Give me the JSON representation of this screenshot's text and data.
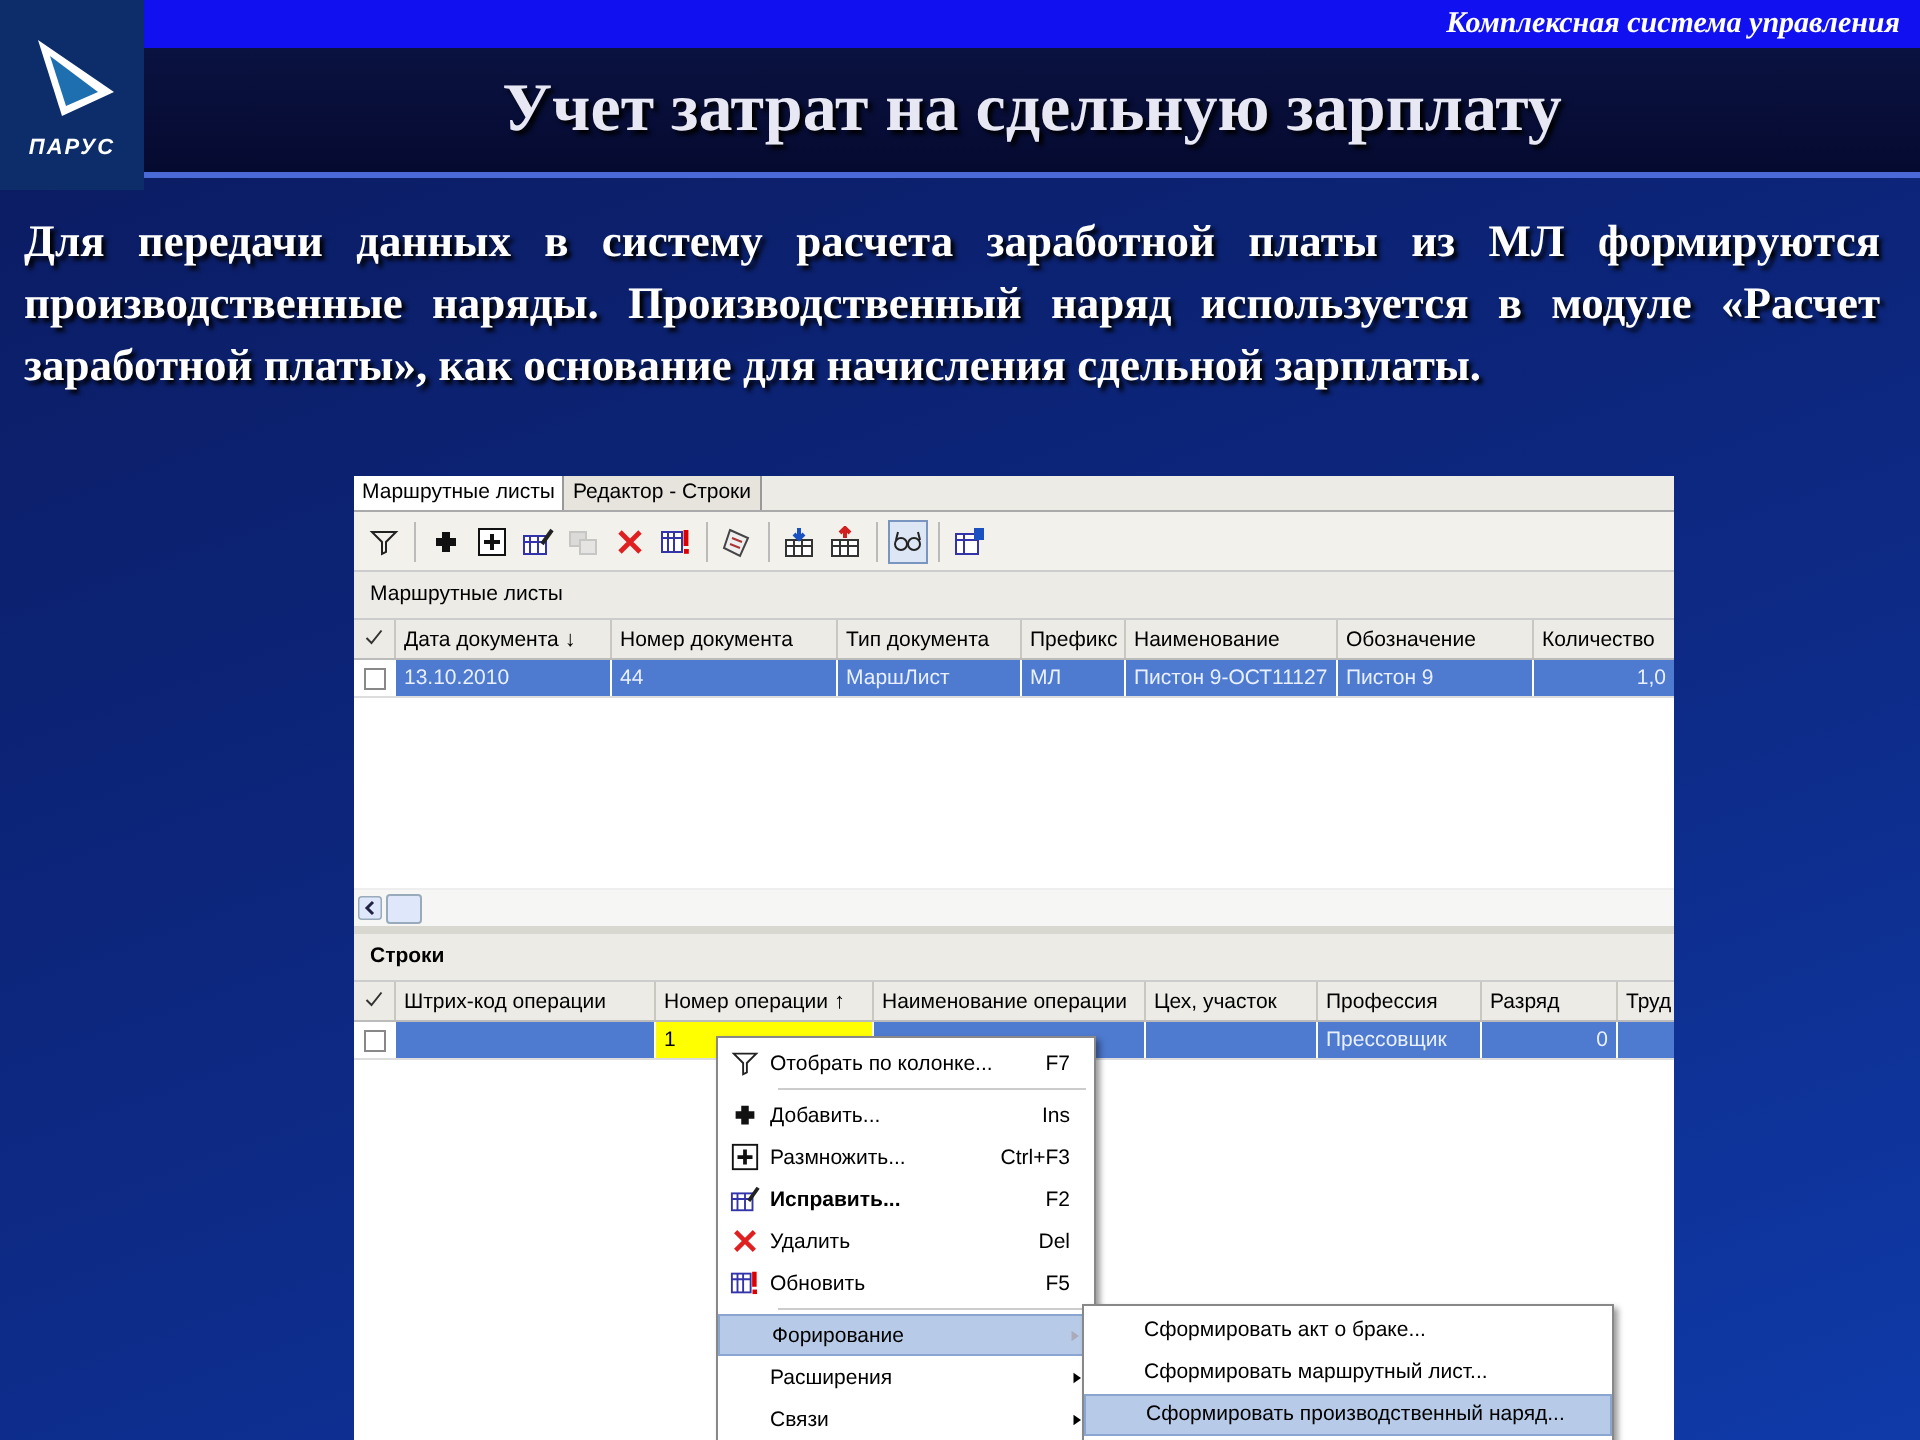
{
  "header": {
    "subtitle": "Комплексная система управления",
    "title": "Учет затрат на сдельную зарплату",
    "logo_text": "ПАРУС"
  },
  "intro": "Для передачи данных в систему расчета заработной платы из МЛ формируются производственные наряды. Производственный наряд используется в модуле «Расчет заработной платы», как основание для начисления сдельной зарплаты.",
  "app": {
    "tabs": [
      {
        "label": "Маршрутные листы",
        "selected": true
      },
      {
        "label": "Редактор - Строки",
        "selected": false
      }
    ],
    "toolbar": [
      {
        "pressed": false
      },
      {
        "pressed": false
      },
      {
        "pressed": false
      },
      {
        "pressed": false
      },
      {
        "pressed": false,
        "disabled": true
      },
      {
        "pressed": false
      },
      {
        "pressed": false
      },
      {
        "pressed": false
      },
      {
        "pressed": false
      },
      {
        "pressed": false
      },
      {
        "pressed": true
      },
      {
        "pressed": false
      }
    ],
    "top_panel": {
      "title": "Маршрутные листы",
      "columns": [
        {
          "label": "Дата документа",
          "sort_arrow": "↓"
        },
        {
          "label": "Номер документа"
        },
        {
          "label": "Тип документа"
        },
        {
          "label": "Префикс"
        },
        {
          "label": "Наименование"
        },
        {
          "label": "Обозначение"
        },
        {
          "label": "Количество"
        }
      ],
      "rows": [
        {
          "checked": false,
          "selected": true,
          "cells": [
            "13.10.2010",
            "44",
            "МаршЛист",
            "МЛ",
            "Пистон 9-ОСТ11127",
            "Пистон 9",
            "1,0"
          ]
        }
      ]
    },
    "bottom_panel": {
      "title": "Строки",
      "columns": [
        {
          "label": "Штрих-код операции"
        },
        {
          "label": "Номер операции",
          "sort_arrow": "↑"
        },
        {
          "label": "Наименование операции"
        },
        {
          "label": "Цех, участок"
        },
        {
          "label": "Профессия"
        },
        {
          "label": "Разряд"
        },
        {
          "label": "Труд"
        }
      ],
      "rows": [
        {
          "checked": false,
          "selected": true,
          "cells": [
            "",
            "1",
            "",
            "",
            "Прессовщик",
            "0",
            ""
          ]
        }
      ]
    },
    "context_menu": [
      {
        "kind": "item",
        "label": "Отобрать по колонке...",
        "shortcut": "F7",
        "default": false,
        "selected": false,
        "submenu": false
      },
      {
        "kind": "separator"
      },
      {
        "kind": "item",
        "label": "Добавить...",
        "shortcut": "Ins",
        "default": false,
        "selected": false,
        "submenu": false
      },
      {
        "kind": "item",
        "label": "Размножить...",
        "shortcut": "Ctrl+F3",
        "default": false,
        "selected": false,
        "submenu": false
      },
      {
        "kind": "item",
        "label": "Исправить...",
        "shortcut": "F2",
        "default": true,
        "selected": false,
        "submenu": false
      },
      {
        "kind": "item",
        "label": "Удалить",
        "shortcut": "Del",
        "default": false,
        "selected": false,
        "submenu": false
      },
      {
        "kind": "item",
        "label": "Обновить",
        "shortcut": "F5",
        "default": false,
        "selected": false,
        "submenu": false
      },
      {
        "kind": "separator"
      },
      {
        "kind": "item",
        "label": "Форирование",
        "default": false,
        "selected": true,
        "submenu": true
      },
      {
        "kind": "item",
        "label": "Расширения",
        "default": false,
        "selected": false,
        "submenu": true
      },
      {
        "kind": "item",
        "label": "Связи",
        "default": false,
        "selected": false,
        "submenu": true
      }
    ],
    "submenu": [
      {
        "label": "Сформировать акт о браке...",
        "selected": false
      },
      {
        "label": "Сформировать маршрутный лист...",
        "selected": false
      },
      {
        "label": "Сформировать производственный наряд...",
        "selected": true
      }
    ]
  }
}
